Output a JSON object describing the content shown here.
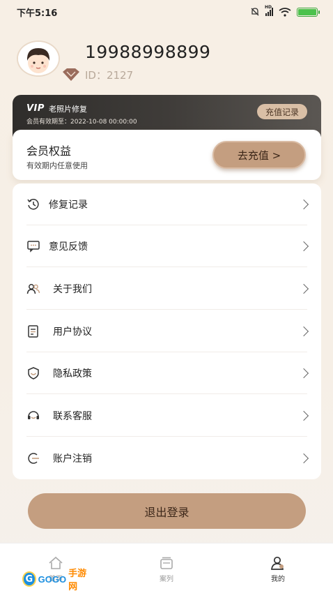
{
  "status_bar": {
    "time": "下午5:16",
    "network": "HD"
  },
  "profile": {
    "phone": "19988998899",
    "id_text": "ID：2127"
  },
  "vip_card": {
    "logo": "VIP",
    "title": "老照片修复",
    "expire": "会员有效期至：2022-10-08 00:00:00",
    "record_label": "充值记录"
  },
  "benefit": {
    "title": "会员权益",
    "subtitle": "有效期内任意使用",
    "recharge_label": "去充值 >"
  },
  "menu": {
    "items": [
      {
        "label": "修复记录",
        "icon": "history-icon"
      },
      {
        "label": "意见反馈",
        "icon": "feedback-icon"
      },
      {
        "label": "关于我们",
        "icon": "users-icon"
      },
      {
        "label": "用户协议",
        "icon": "document-icon"
      },
      {
        "label": "隐私政策",
        "icon": "shield-icon"
      },
      {
        "label": "联系客服",
        "icon": "service-icon"
      },
      {
        "label": "账户注销",
        "icon": "cancel-account-icon"
      }
    ]
  },
  "logout_label": "退出登录",
  "tabbar": {
    "tabs": [
      {
        "label": "首页",
        "icon": "home-icon"
      },
      {
        "label": "案列",
        "icon": "cases-icon"
      },
      {
        "label": "我的",
        "icon": "profile-icon"
      }
    ]
  },
  "watermark": {
    "badge": "G",
    "brand": "GOGO",
    "suffix": "手游网"
  },
  "colors": {
    "accent": "#c49e80",
    "vip_dark": "#3f3c39",
    "background": "#f7efe5"
  }
}
